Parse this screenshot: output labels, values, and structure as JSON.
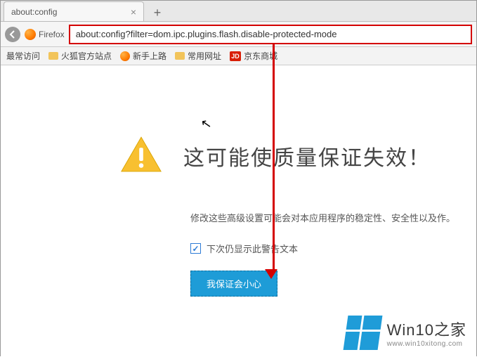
{
  "tab": {
    "title": "about:config"
  },
  "nav": {
    "firefox_label": "Firefox",
    "url": "about:config?filter=dom.ipc.plugins.flash.disable-protected-mode"
  },
  "bookmarks": {
    "most_visited": "最常访问",
    "firefox_sites": "火狐官方站点",
    "getting_started": "新手上路",
    "common_sites": "常用网址",
    "jd_label": "JD",
    "jd_text": "京东商城"
  },
  "warning": {
    "title": "这可能使质量保证失效！",
    "desc": "修改这些高级设置可能会对本应用程序的稳定性、安全性以及作。",
    "checkbox_label": "下次仍显示此警告文本",
    "button": "我保证会小心"
  },
  "watermark": {
    "main": "Win10之家",
    "sub": "www.win10xitong.com"
  }
}
